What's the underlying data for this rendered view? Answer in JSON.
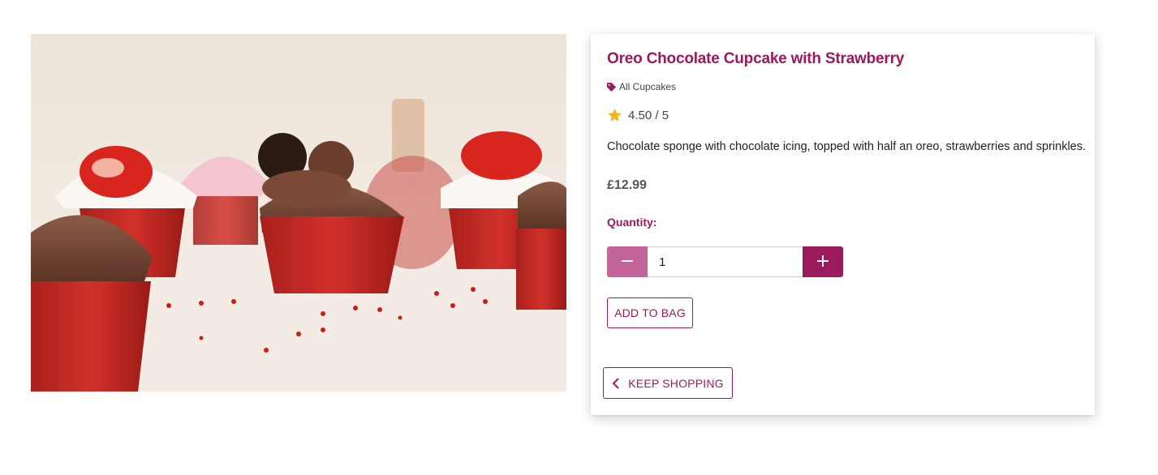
{
  "product": {
    "image_alt": "Oreo Chocolate Cupcake with Strawberry",
    "name": "Oreo Chocolate Cupcake with Strawberry",
    "category": "All Cupcakes",
    "rating": "4.50 / 5",
    "description": "Chocolate sponge with chocolate icing, topped with half an oreo, strawberries and sprinkles.",
    "price": "£12.99"
  },
  "quantity": {
    "label": "Quantity:",
    "value": "1"
  },
  "actions": {
    "add_to_bag": "ADD TO BAG",
    "keep_shopping": "KEEP SHOPPING"
  },
  "icons": {
    "category": "tag-icon",
    "rating": "star-icon",
    "decrement": "minus-icon",
    "increment": "plus-icon",
    "back": "chevron-left-icon"
  },
  "colors": {
    "brand": "#9b1a5e",
    "brand_light": "#c5649a",
    "star": "#f5b31b"
  }
}
